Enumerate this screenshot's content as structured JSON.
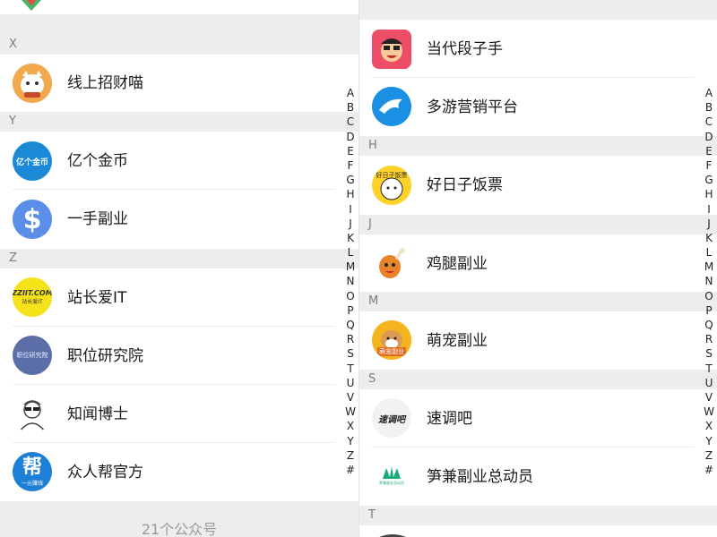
{
  "left": {
    "sections": {
      "x": "X",
      "y": "Y",
      "z": "Z"
    },
    "items": [
      {
        "name": "线上招财喵"
      },
      {
        "name": "亿个金币",
        "avatar_text": "亿个金币"
      },
      {
        "name": "一手副业",
        "avatar_text": "$"
      },
      {
        "name": "站长爱IT",
        "avatar_text": "ZZIIT.COM",
        "avatar_sub": "站长爱IT"
      },
      {
        "name": "职位研究院",
        "avatar_text": "职位研究院"
      },
      {
        "name": "知闻博士"
      },
      {
        "name": "众人帮官方",
        "avatar_text": "帮",
        "avatar_sub": "一元赚钱"
      }
    ],
    "footer": "21个公众号"
  },
  "right": {
    "sections": {
      "h": "H",
      "j": "J",
      "m": "M",
      "s": "S",
      "t": "T"
    },
    "items": [
      {
        "name": "当代段子手"
      },
      {
        "name": "多游营销平台"
      },
      {
        "name": "好日子饭票",
        "avatar_text": "好日子饭票"
      },
      {
        "name": "鸡腿副业"
      },
      {
        "name": "萌宠副业",
        "avatar_text": "萌宠副业"
      },
      {
        "name": "速调吧",
        "avatar_text": "速调吧"
      },
      {
        "name": "笋兼副业总动员",
        "avatar_text": "笋兼副业总动员"
      }
    ]
  },
  "index_letters": [
    "A",
    "B",
    "C",
    "D",
    "E",
    "F",
    "G",
    "H",
    "I",
    "J",
    "K",
    "L",
    "M",
    "N",
    "O",
    "P",
    "Q",
    "R",
    "S",
    "T",
    "U",
    "V",
    "W",
    "X",
    "Y",
    "Z",
    "#"
  ],
  "colors": {
    "list_bg": "#ffffff",
    "section_bg": "#ededed",
    "section_text": "#7d7d7d",
    "name_text": "#191919",
    "footer_text": "#9a9a9a"
  }
}
